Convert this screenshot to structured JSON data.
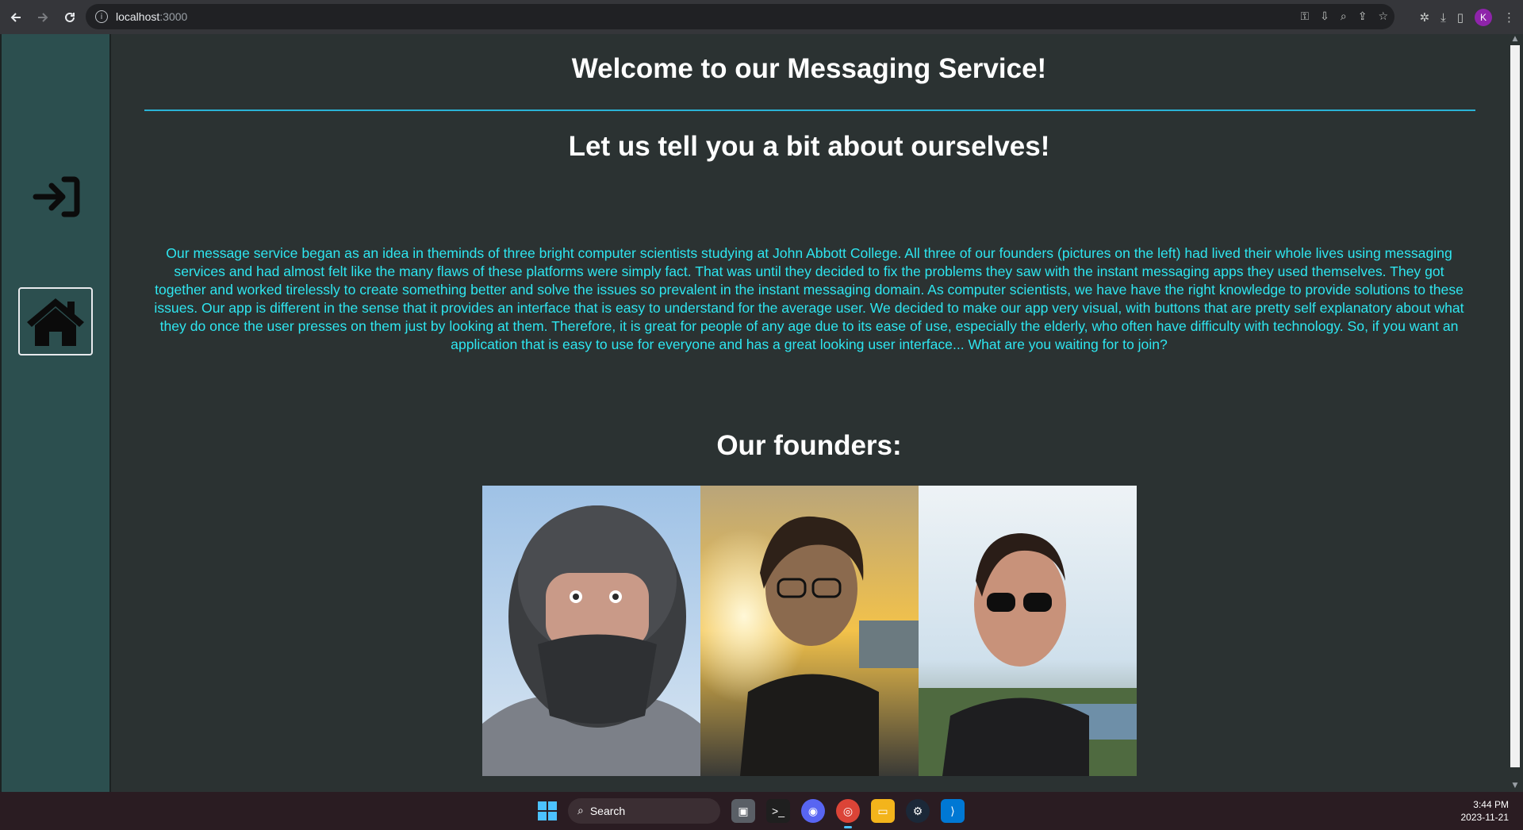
{
  "browser": {
    "url_host": "localhost",
    "url_port": ":3000",
    "profile_initial": "K"
  },
  "page": {
    "welcome_title": "Welcome to our Messaging Service!",
    "subtitle": "Let us tell you a bit about ourselves!",
    "about_text": "Our message service began as an idea in theminds of three bright computer scientists studying at John Abbott College. All three of our founders (pictures on the left) had lived their whole lives using messaging services and had almost felt like the many flaws of these platforms were simply fact. That was until they decided to fix the problems they saw with the instant messaging apps they used themselves. They got together and worked tirelessly to create something better and solve the issues so prevalent in the instant messaging domain. As computer scientists, we have have the right knowledge to provide solutions to these issues. Our app is different in the sense that it provides an interface that is easy to understand for the average user. We decided to make our app very visual, with buttons that are pretty self explanatory about what they do once the user presses on them just by looking at them. Therefore, it is great for people of any age due to its ease of use, especially the elderly, who often have difficulty with technology. So, if you want an application that is easy to use for everyone and has a great looking user interface... What are you waiting for to join?",
    "founders_title": "Our founders:"
  },
  "sidebar": {
    "icons": [
      "login-icon",
      "home-icon"
    ]
  },
  "taskbar": {
    "search_label": "Search",
    "time": "3:44 PM",
    "date": "2023-11-21"
  },
  "colors": {
    "page_bg": "#2b3232",
    "sidebar_bg": "#2c4f4f",
    "about_text": "#2ee6f0",
    "divider": "#2ab3d6"
  }
}
